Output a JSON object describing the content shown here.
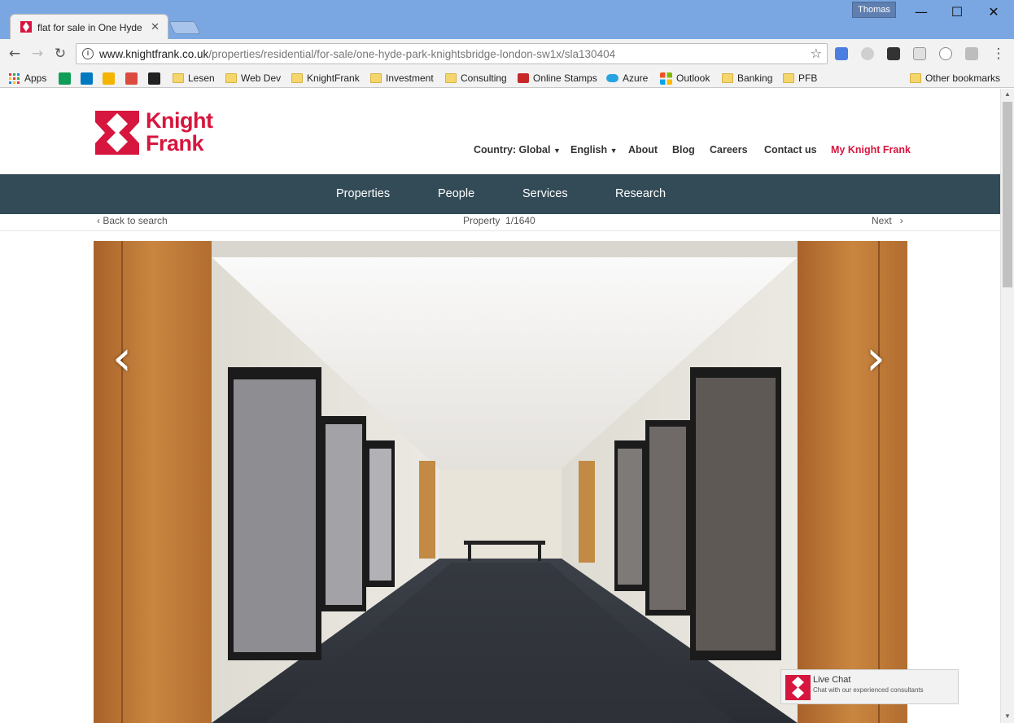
{
  "browser": {
    "tab_title": "flat for sale in One Hyde",
    "profile_name": "Thomas",
    "url_host": "www.knightfrank.co.uk",
    "url_path": "/properties/residential/for-sale/one-hyde-park-knightsbridge-london-sw1x/sla130404",
    "bookmarks": [
      {
        "label": "Apps",
        "icon": "apps-grid-icon"
      },
      {
        "label": "",
        "icon": "sheets-icon"
      },
      {
        "label": "",
        "icon": "trello-icon"
      },
      {
        "label": "",
        "icon": "keep-icon"
      },
      {
        "label": "",
        "icon": "todoist-icon"
      },
      {
        "label": "",
        "icon": "buffer-icon"
      },
      {
        "label": "Lesen",
        "icon": "folder-icon"
      },
      {
        "label": "Web Dev",
        "icon": "folder-icon"
      },
      {
        "label": "KnightFrank",
        "icon": "folder-icon"
      },
      {
        "label": "Investment",
        "icon": "folder-icon"
      },
      {
        "label": "Consulting",
        "icon": "folder-icon"
      },
      {
        "label": "Online Stamps",
        "icon": "stamp-icon"
      },
      {
        "label": "Azure",
        "icon": "cloud-icon"
      },
      {
        "label": "Outlook",
        "icon": "microsoft-icon"
      },
      {
        "label": "Banking",
        "icon": "folder-icon"
      },
      {
        "label": "PFB",
        "icon": "folder-icon"
      }
    ],
    "other_bookmarks": "Other bookmarks"
  },
  "site": {
    "logo_line1": "Knight",
    "logo_line2": "Frank",
    "brand_color": "#d6163e",
    "nav_color": "#334b57",
    "top_nav": {
      "country": "Country: Global",
      "language": "English",
      "about": "About",
      "blog": "Blog",
      "careers": "Careers",
      "contact": "Contact us",
      "my_account": "My Knight Frank"
    },
    "main_nav": [
      "Properties",
      "People",
      "Services",
      "Research"
    ],
    "back_to_search": "Back to search",
    "property_label": "Property",
    "property_counter": "1/1640",
    "next_label": "Next",
    "live_chat": {
      "title": "Live Chat",
      "subtitle": "Chat with our experienced consultants"
    }
  }
}
